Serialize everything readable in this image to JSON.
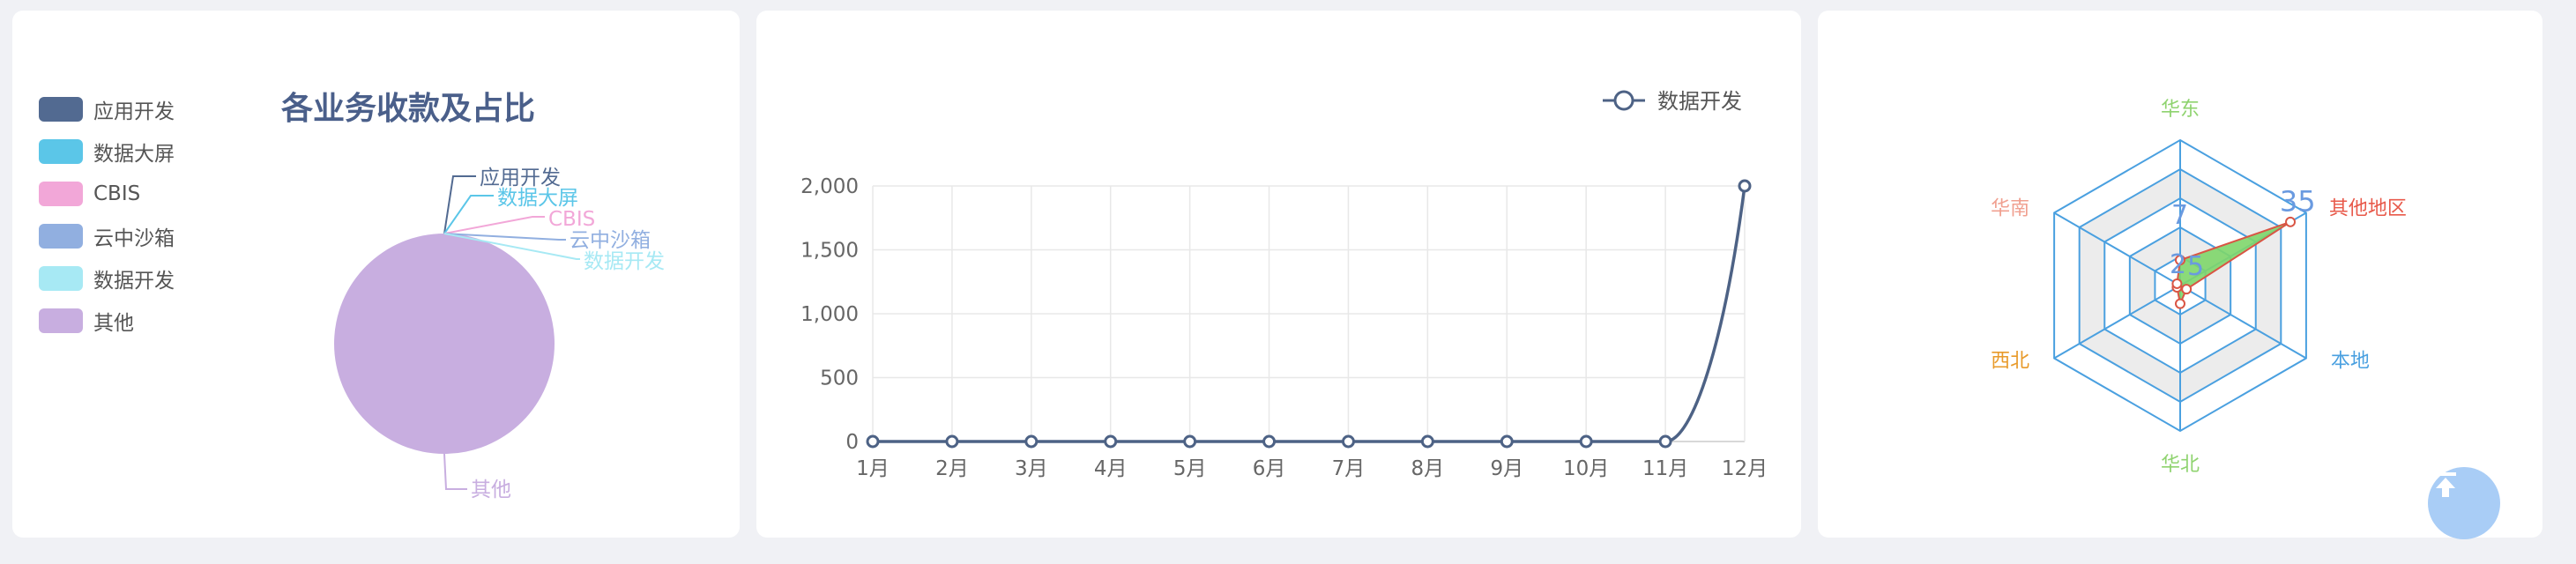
{
  "colors": {
    "pie": [
      "#526a91",
      "#5bc6e8",
      "#f2a7d8",
      "#91afe0",
      "#a7e9f4",
      "#c8aee0"
    ],
    "line": "#4d6285",
    "radar_grid": "#4aa0e0",
    "radar_fill": "#7ed66a",
    "radar_stroke": "#d95544"
  },
  "pie": {
    "title": "各业务收款及占比",
    "legend": [
      "应用开发",
      "数据大屏",
      "CBIS",
      "云中沙箱",
      "数据开发",
      "其他"
    ],
    "chart_data": {
      "type": "pie",
      "title": "各业务收款及占比",
      "labels": [
        "应用开发",
        "数据大屏",
        "CBIS",
        "云中沙箱",
        "数据开发",
        "其他"
      ],
      "values": [
        0,
        0,
        0,
        0,
        0,
        100
      ]
    }
  },
  "line": {
    "legend": "数据开发",
    "chart_data": {
      "type": "line",
      "categories": [
        "1月",
        "2月",
        "3月",
        "4月",
        "5月",
        "6月",
        "7月",
        "8月",
        "9月",
        "10月",
        "11月",
        "12月"
      ],
      "series": [
        {
          "name": "数据开发",
          "values": [
            0,
            0,
            0,
            0,
            0,
            0,
            0,
            0,
            0,
            0,
            0,
            2000
          ]
        }
      ],
      "ylim": [
        0,
        2000
      ],
      "yticks": [
        "2,000",
        "1,500",
        "1,000",
        "500",
        "0"
      ]
    }
  },
  "radar": {
    "chart_data": {
      "type": "radar",
      "indicators": [
        "华东",
        "其他地区",
        "本地",
        "华北",
        "西北",
        "华南"
      ],
      "max": 40,
      "values": [
        7,
        35,
        2,
        5,
        1,
        1
      ],
      "value_labels": [
        "7",
        "35",
        "2",
        "5"
      ]
    }
  },
  "back_to_top_icon": "arrow-up-to-top-icon"
}
